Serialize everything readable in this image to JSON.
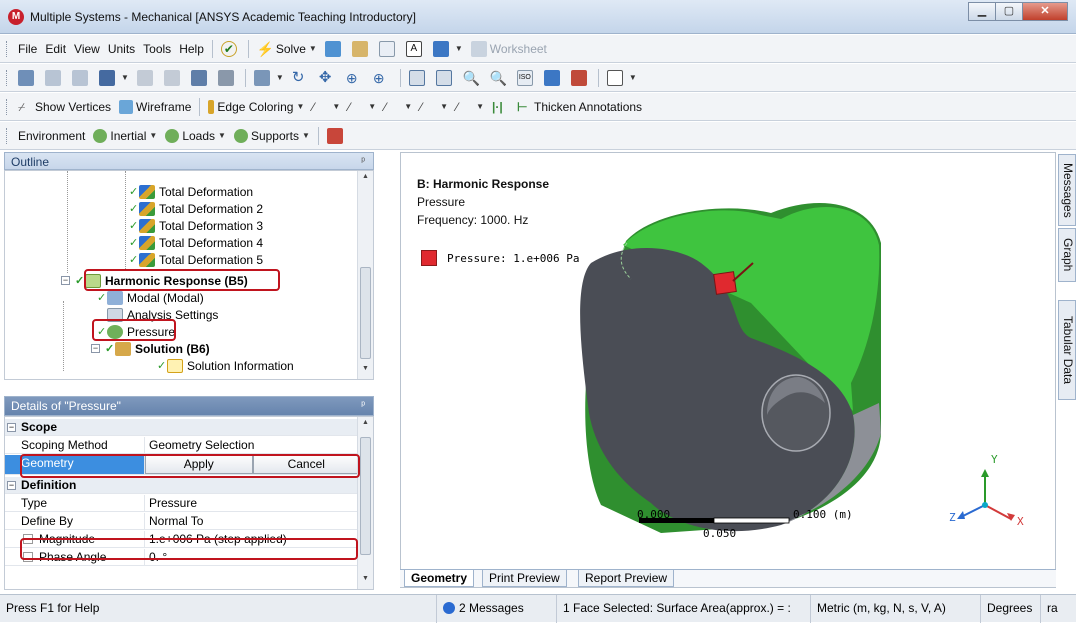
{
  "window": {
    "title": "Multiple Systems - Mechanical [ANSYS Academic Teaching Introductory]",
    "app_icon_letter": "M"
  },
  "menu": {
    "items": [
      "File",
      "Edit",
      "View",
      "Units",
      "Tools",
      "Help"
    ],
    "solve_label": "Solve",
    "worksheet_label": "Worksheet"
  },
  "toolbar3": {
    "show_vertices": "Show Vertices",
    "wireframe": "Wireframe",
    "edge_coloring": "Edge Coloring",
    "thicken_annotations": "Thicken Annotations"
  },
  "toolbar4": {
    "environment": "Environment",
    "inertial": "Inertial",
    "loads": "Loads",
    "supports": "Supports"
  },
  "outline": {
    "header": "Outline",
    "items": [
      "Total Deformation",
      "Total Deformation 2",
      "Total Deformation 3",
      "Total Deformation 4",
      "Total Deformation 5",
      "Harmonic Response (B5)",
      "Modal (Modal)",
      "Analysis Settings",
      "Pressure",
      "Solution (B6)",
      "Solution Information"
    ]
  },
  "details": {
    "header": "Details of \"Pressure\"",
    "scope_label": "Scope",
    "scoping_method_key": "Scoping Method",
    "scoping_method_value": "Geometry Selection",
    "geometry_key": "Geometry",
    "apply_label": "Apply",
    "cancel_label": "Cancel",
    "definition_label": "Definition",
    "type_key": "Type",
    "type_value": "Pressure",
    "define_by_key": "Define By",
    "define_by_value": "Normal To",
    "magnitude_key": "Magnitude",
    "magnitude_value": "1.e+006 Pa  (step applied)",
    "phase_angle_key": "Phase Angle",
    "phase_angle_value": "0. °"
  },
  "viewport": {
    "title": "B: Harmonic Response",
    "subtitle": "Pressure",
    "frequency": "Frequency: 1000. Hz",
    "legend_label": "Pressure: 1.e+006 Pa",
    "scale_left": "0.000",
    "scale_right": "0.100 (m)",
    "scale_mid": "0.050",
    "axis_x": "X",
    "axis_y": "Y",
    "axis_z": "Z",
    "colors": {
      "body_green": "#3fc43f",
      "body_gray": "#4a4d55",
      "load_red": "#e0292f"
    }
  },
  "side_tabs": [
    "Messages",
    "Graph",
    "Tabular Data"
  ],
  "bottom_tabs": [
    "Geometry",
    "Print Preview",
    "Report Preview"
  ],
  "status": {
    "help": "Press F1 for Help",
    "messages": "2 Messages",
    "selection": "1 Face Selected: Surface Area(approx.) = :",
    "units": "Metric (m, kg, N, s, V, A)",
    "angle": "Degrees",
    "extra": "ra"
  }
}
